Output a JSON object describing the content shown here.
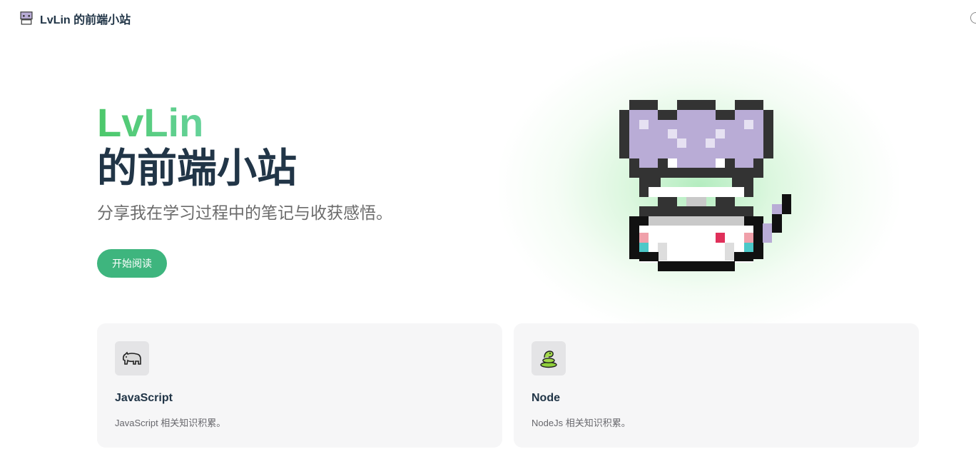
{
  "nav": {
    "logo_icon": "pixel-cat-icon",
    "title": "LvLin 的前端小站"
  },
  "hero": {
    "name": "LvLin",
    "text": "的前端小站",
    "tagline": "分享我在学习过程中的笔记与收获感悟。",
    "action_label": "开始阅读",
    "image_icon": "pixel-cat-mascot",
    "brand_color": "#3eb57e"
  },
  "features": [
    {
      "icon": "rhinoceros-icon",
      "title": "JavaScript",
      "details": "JavaScript 相关知识积累。"
    },
    {
      "icon": "snake-icon",
      "title": "Node",
      "details": "NodeJs 相关知识积累。"
    }
  ]
}
